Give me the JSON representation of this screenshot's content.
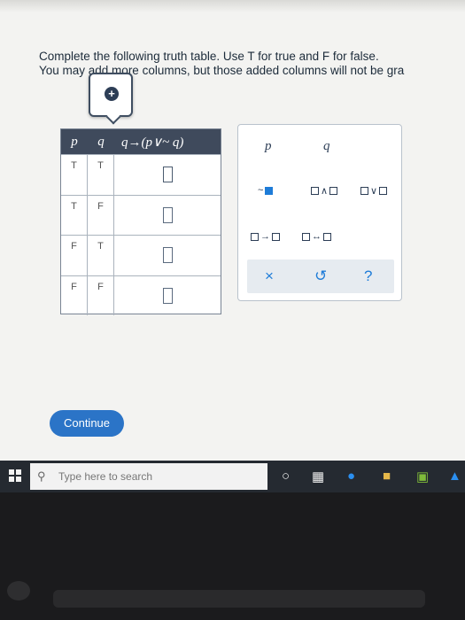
{
  "instructions": {
    "line1": "Complete the following truth table. Use T for true and F for false.",
    "line2": "You may add more columns, but those added columns will not be gra"
  },
  "add_column_popup": {
    "icon": "plus-circle-icon"
  },
  "truth_table": {
    "headers": [
      "p",
      "q",
      "q→(p∨~ q)"
    ],
    "rows": [
      {
        "p": "T",
        "q": "T",
        "answer": ""
      },
      {
        "p": "T",
        "q": "F",
        "answer": ""
      },
      {
        "p": "F",
        "q": "T",
        "answer": ""
      },
      {
        "p": "F",
        "q": "F",
        "answer": ""
      }
    ]
  },
  "palette": {
    "variables": [
      "p",
      "q"
    ],
    "operators": {
      "not": "~",
      "and": "∧",
      "or": "∨",
      "implies": "→",
      "iff": "↔"
    },
    "actions": {
      "clear": "×",
      "undo": "↺",
      "help": "?"
    }
  },
  "continue_button": {
    "label": "Continue"
  },
  "taskbar": {
    "search_placeholder": "Type here to search"
  },
  "colors": {
    "accent": "#1e7cd8",
    "header_bg": "#3f4a5c",
    "continue_bg": "#2b74c7"
  }
}
